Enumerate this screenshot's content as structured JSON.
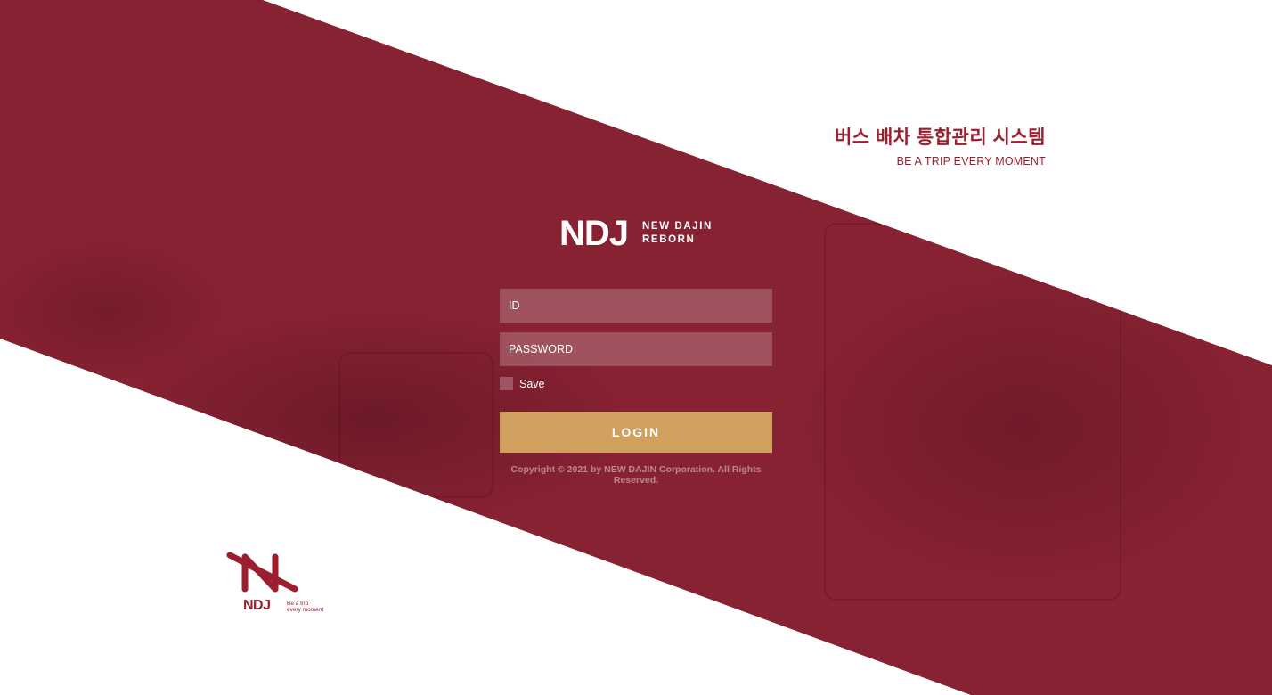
{
  "header": {
    "title_kr": "버스 배차 통합관리 시스템",
    "subtitle_en": "BE A TRIP EVERY MOMENT"
  },
  "logo": {
    "mark": "NDJ",
    "line1": "NEW DAJIN",
    "line2": "REBORN"
  },
  "form": {
    "id_placeholder": "ID",
    "password_placeholder": "PASSWORD",
    "save_label": "Save",
    "login_label": "LOGIN"
  },
  "footer": {
    "copyright": "Copyright © 2021 by NEW DAJIN Corporation. All Rights Reserved."
  },
  "corner_logo": {
    "mark": "NDJ",
    "tagline1": "Be a trip",
    "tagline2": "every moment"
  },
  "colors": {
    "brand": "#872232",
    "accent": "#d0a05e",
    "title": "#9b1f2e"
  }
}
